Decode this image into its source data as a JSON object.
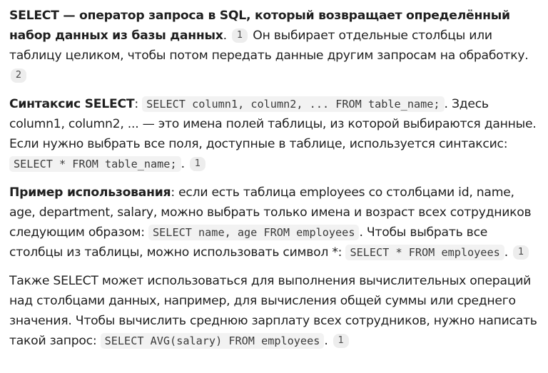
{
  "p1": {
    "bold": "SELECT — оператор запроса в SQL, который возвращает определённый набор данных из базы данных",
    "text1": ".",
    "ref1": "1",
    "text2": " Он выбирает отдельные столбцы или таблицу целиком, чтобы потом передать данные другим запросам на обработку.",
    "ref2": "2"
  },
  "p2": {
    "bold": "Синтаксис SELECT",
    "text1": ": ",
    "code1": "SELECT column1, column2, ... FROM table_name;",
    "text2": ". Здесь column1, column2, ... — это имена полей таблицы, из которой выбираются данные. Если нужно выбрать все поля, доступные в таблице, используется синтаксис: ",
    "code2": "SELECT * FROM table_name;",
    "text3": ".",
    "ref1": "1"
  },
  "p3": {
    "bold": "Пример использования",
    "text1": ": если есть таблица employees со столбцами id, name, age, department, salary, можно выбрать только имена и возраст всех сотрудников следующим образом: ",
    "code1": "SELECT name, age FROM employees",
    "text2": ". Чтобы выбрать все столбцы из таблицы, можно использовать символ *: ",
    "code2": "SELECT * FROM employees",
    "text3": ".",
    "ref1": "1"
  },
  "p4": {
    "text1": "Также SELECT может использоваться для выполнения вычислительных операций над столбцами данных, например, для вычисления общей суммы или среднего значения. Чтобы вычислить среднюю зарплату всех сотрудников, нужно написать такой запрос: ",
    "code1": "SELECT AVG(salary) FROM employees",
    "text2": ".",
    "ref1": "1"
  }
}
